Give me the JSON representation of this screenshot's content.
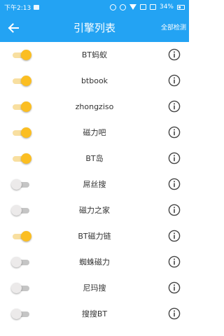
{
  "status_bar": {
    "time": "下午2:13",
    "battery": "34%"
  },
  "app_bar": {
    "title": "引擎列表",
    "action_label": "全部检测"
  },
  "colors": {
    "primary": "#23a3f3",
    "toggle_on_thumb": "#fbbe22",
    "toggle_on_track": "#f8dfa0",
    "toggle_off_thumb": "#eceaea",
    "toggle_off_track": "#c5c5c5",
    "info_icon": "#444444"
  },
  "engines": [
    {
      "name": "BT蚂蚁",
      "enabled": true
    },
    {
      "name": "btbook",
      "enabled": true
    },
    {
      "name": "zhongziso",
      "enabled": true
    },
    {
      "name": "磁力吧",
      "enabled": true
    },
    {
      "name": "BT岛",
      "enabled": true
    },
    {
      "name": "屌丝搜",
      "enabled": false
    },
    {
      "name": "磁力之家",
      "enabled": false
    },
    {
      "name": "BT磁力链",
      "enabled": true
    },
    {
      "name": "蜘蛛磁力",
      "enabled": false
    },
    {
      "name": "尼玛搜",
      "enabled": false
    },
    {
      "name": "搜搜BT",
      "enabled": false
    }
  ]
}
